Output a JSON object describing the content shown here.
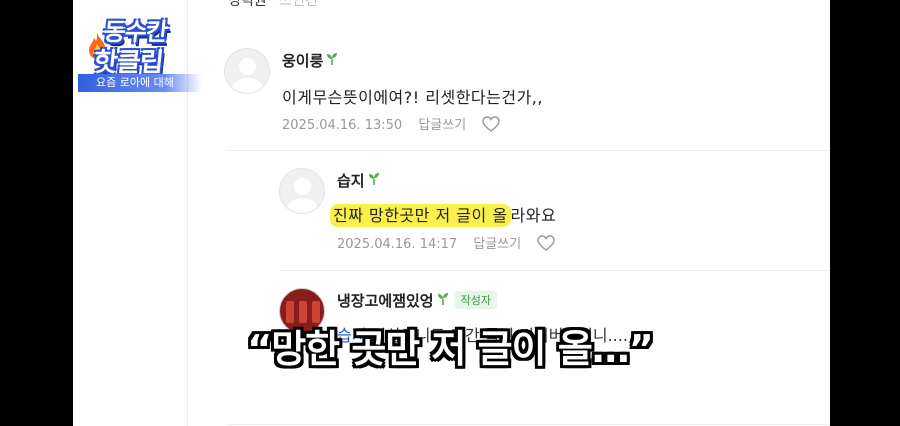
{
  "logo": {
    "line1": "동수칸",
    "line2": "핫클립",
    "subtitle": "요즘 로아에 대해"
  },
  "top_partial": {
    "name": "성덕원",
    "dim": "쓰인건"
  },
  "comments": [
    {
      "nickname": "웅이룽",
      "text": "이게무슨뜻이에여?! 리셋한다는건가,,",
      "date": "2025.04.16. 13:50",
      "reply_label": "답글쓰기"
    },
    {
      "nickname": "습지",
      "text_highlight": "진짜 망한곳만 저 글이 올",
      "text_rest": "라와요",
      "date": "2025.04.16. 14:17",
      "reply_label": "답글쓰기"
    },
    {
      "nickname": "냉장고에잼있엉",
      "author_badge": "작성자",
      "mention": "습지",
      "text_partial": " 벼삼로니도 가간 툭이 티이버렸더니...."
    }
  ],
  "caption": "“망한 곳만 저 글이 올…”",
  "colors": {
    "highlight": "#fbf04a",
    "sprout": "#4caf50",
    "mention": "#1a55c9"
  }
}
